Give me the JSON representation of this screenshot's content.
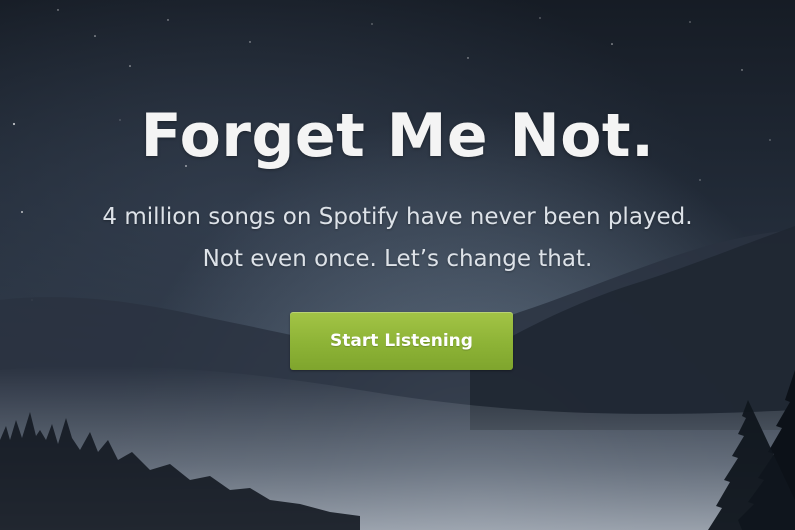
{
  "hero": {
    "headline": "Forget Me Not.",
    "subline_1": "4 million songs on Spotify have never been played.",
    "subline_2": "Not even once. Let’s change that.",
    "cta_label": "Start Listening"
  },
  "colors": {
    "background": "#1e2632",
    "headline_text": "#f4f4f4",
    "body_text": "#dde2e8",
    "cta_background": "#8db336",
    "cta_text": "#ffffff"
  },
  "background_image": "night-forest-mountains-mist"
}
